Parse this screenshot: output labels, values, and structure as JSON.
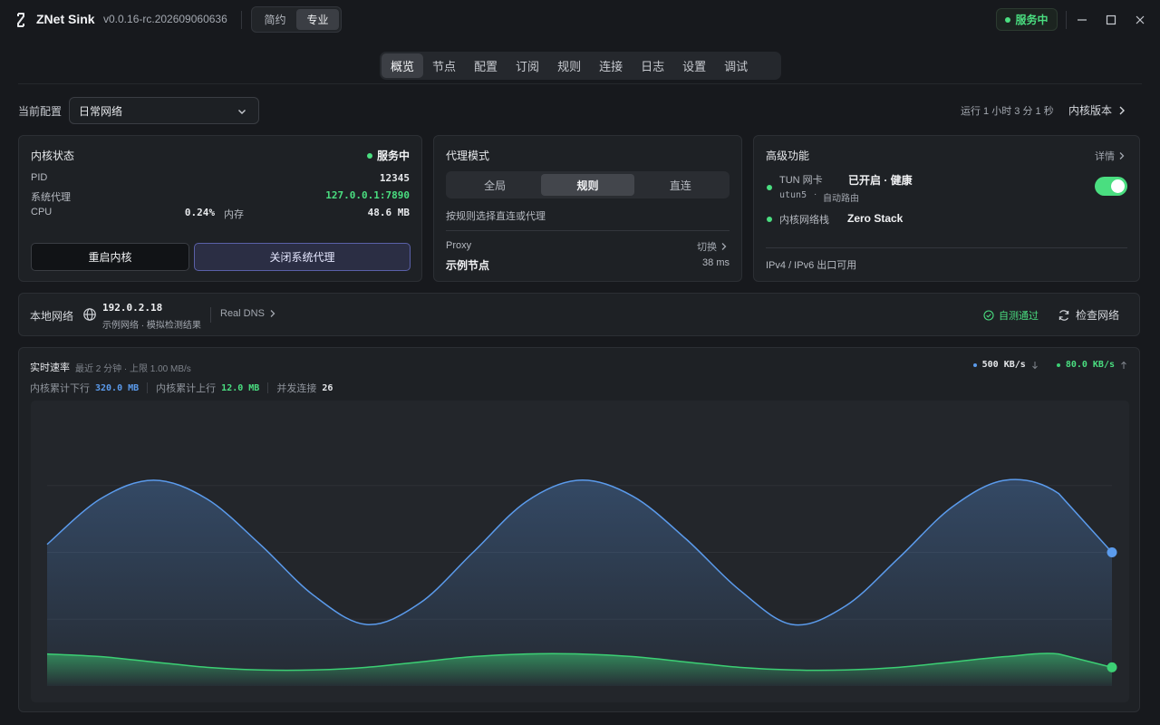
{
  "titlebar": {
    "app_name": "ZNet Sink",
    "version": "v0.0.16-rc.202609060636",
    "modes": [
      "简约",
      "专业"
    ],
    "active_mode": "专业",
    "status": "服务中"
  },
  "nav": {
    "tabs": [
      "概览",
      "节点",
      "配置",
      "订阅",
      "规则",
      "连接",
      "日志",
      "设置",
      "调试"
    ],
    "active": "概览"
  },
  "config": {
    "label": "当前配置",
    "selected": "日常网络",
    "uptime": "运行 1 小时 3 分 1 秒",
    "kernel_version_link": "内核版本"
  },
  "kernel_card": {
    "title": "内核状态",
    "status": "服务中",
    "pid_label": "PID",
    "pid": "12345",
    "sys_proxy_label": "系统代理",
    "sys_proxy": "127.0.0.1:7890",
    "cpu_label": "CPU",
    "cpu": "0.24%",
    "mem_label": "内存",
    "mem": "48.6 MB",
    "restart_button": "重启内核",
    "close_proxy_button": "关闭系统代理"
  },
  "proxy_card": {
    "title": "代理模式",
    "modes": [
      "全局",
      "规则",
      "直连"
    ],
    "active_mode": "规则",
    "description": "按规则选择直连或代理",
    "group_label": "Proxy",
    "switch_label": "切换",
    "node_name": "示例节点",
    "latency": "38 ms"
  },
  "advanced_card": {
    "title": "高级功能",
    "details_link": "详情",
    "tun_label": "TUN 网卡",
    "tun_status": "已开启 · 健康",
    "tun_device": "utun5",
    "tun_route": "自动路由",
    "tun_enabled": true,
    "stack_label": "内核网络栈",
    "stack_value": "Zero Stack",
    "ip_status": "IPv4 / IPv6 出口可用"
  },
  "local_network": {
    "label": "本地网络",
    "ip": "192.0.2.18",
    "sub": "示例网络 · 模拟检测结果",
    "dns_link": "Real DNS",
    "self_test": "自测通过",
    "check_button": "检查网络"
  },
  "speed": {
    "title": "实时速率",
    "subtitle": "最近 2 分钟 · 上限 1.00 MB/s",
    "down_rate": "500 KB/s",
    "up_rate": "80.0 KB/s",
    "total_down_label": "内核累计下行",
    "total_down": "320.0 MB",
    "total_up_label": "内核累计上行",
    "total_up": "12.0 MB",
    "connections_label": "并发连接",
    "connections": "26"
  },
  "colors": {
    "accent_green": "#4ade80",
    "download_blue": "#5b9bec",
    "upload_green": "#3ccf74",
    "accent_purple": "#5a60a8"
  },
  "chart_data": {
    "type": "area",
    "series": [
      {
        "values": [
          0.53,
          0.7,
          0.77,
          0.7,
          0.53,
          0.34,
          0.23,
          0.31,
          0.5,
          0.69,
          0.77,
          0.71,
          0.55,
          0.36,
          0.23,
          0.3,
          0.48,
          0.67,
          0.77,
          0.72,
          0.5
        ]
      },
      {
        "values": [
          0.12,
          0.11,
          0.09,
          0.07,
          0.06,
          0.06,
          0.07,
          0.09,
          0.11,
          0.12,
          0.12,
          0.11,
          0.09,
          0.07,
          0.06,
          0.06,
          0.07,
          0.09,
          0.11,
          0.12,
          0.07
        ]
      }
    ],
    "ylim": [
      0,
      1.0
    ]
  }
}
